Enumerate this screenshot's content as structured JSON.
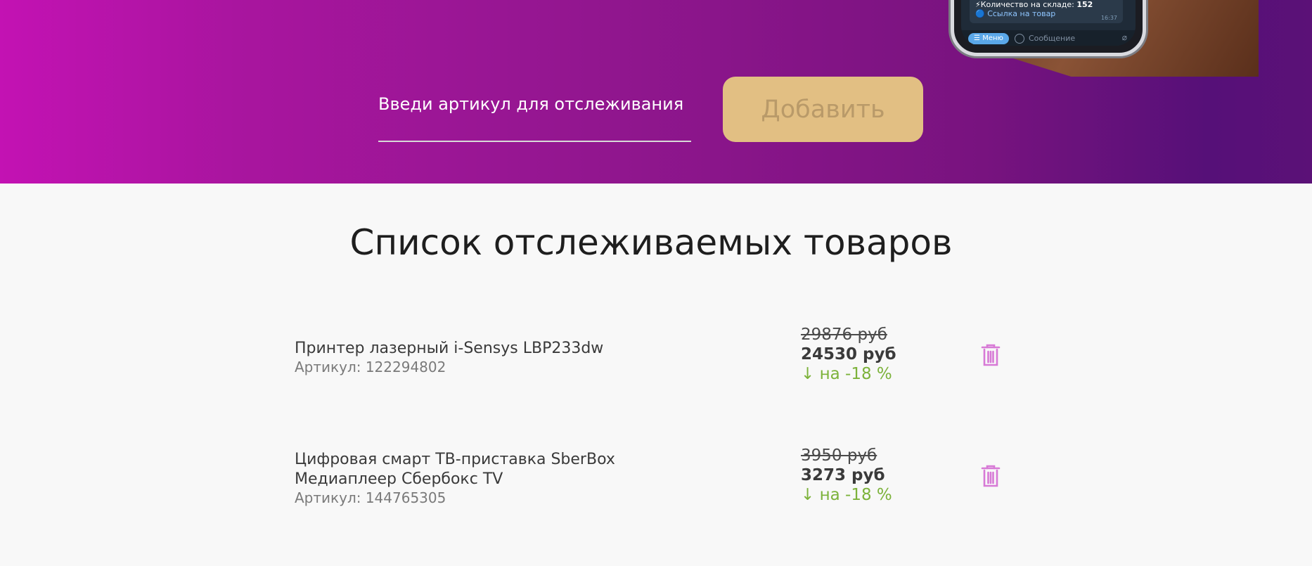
{
  "hero": {
    "phone_message": {
      "stock_label": "⚡Количество на складе:",
      "stock_value": "152",
      "link_label": "🔵 Ссылка на товар",
      "time": "16:37",
      "menu_label": "☰ Меню",
      "input_placeholder": "Сообщение"
    },
    "sku_input": {
      "placeholder": "Введи артикул для отслеживания",
      "value": ""
    },
    "add_button_label": "Добавить",
    "colors": {
      "gradient_start": "#c312b3",
      "gradient_end": "#5b1177",
      "button": "#e2bf83"
    }
  },
  "tracked": {
    "title": "Список отслеживаемых товаров",
    "items": [
      {
        "name_lines": [
          "Принтер лазерный i-Sensys LBP233dw"
        ],
        "sku_text": "Артикул: 122294802",
        "old_price": "29876 руб",
        "new_price": "24530 руб",
        "discount": "↓ на -18 %"
      },
      {
        "name_lines": [
          "Цифровая смарт ТВ-приставка SberBox",
          "Медиаплеер Сбербокс TV"
        ],
        "sku_text": "Артикул: 144765305",
        "old_price": "3950 руб",
        "new_price": "3273 руб",
        "discount": "↓ на -18 %"
      }
    ],
    "colors": {
      "discount": "#7cb23a",
      "delete_icon": "#d77ad6"
    },
    "delete_icon": "trash-icon"
  }
}
